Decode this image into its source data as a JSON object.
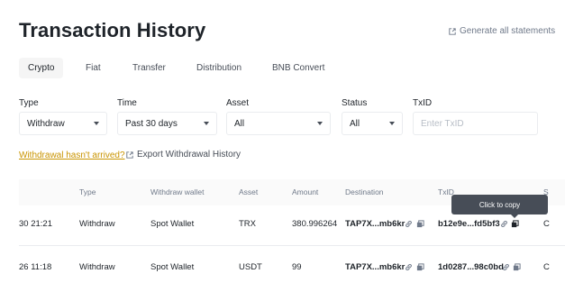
{
  "header": {
    "title": "Transaction History",
    "generate_statements": "Generate all statements"
  },
  "tabs": [
    "Crypto",
    "Fiat",
    "Transfer",
    "Distribution",
    "BNB Convert"
  ],
  "filters": {
    "type": {
      "label": "Type",
      "value": "Withdraw"
    },
    "time": {
      "label": "Time",
      "value": "Past 30 days"
    },
    "asset": {
      "label": "Asset",
      "value": "All"
    },
    "status": {
      "label": "Status",
      "value": "All"
    },
    "txid": {
      "label": "TxID",
      "placeholder": "Enter TxID"
    }
  },
  "links": {
    "withdrawal_not_arrived": "Withdrawal hasn't arrived?",
    "export_history": "Export Withdrawal History"
  },
  "table": {
    "columns": [
      "Type",
      "Withdraw wallet",
      "Asset",
      "Amount",
      "Destination",
      "TxID",
      "S"
    ],
    "rows": [
      {
        "time": "30 21:21",
        "type": "Withdraw",
        "wallet": "Spot Wallet",
        "asset": "TRX",
        "amount": "380.996264",
        "destination": "TAP7X...mb6kr",
        "txid": "b12e9e...fd5bf3",
        "status": "C"
      },
      {
        "time": "26 11:18",
        "type": "Withdraw",
        "wallet": "Spot Wallet",
        "asset": "USDT",
        "amount": "99",
        "destination": "TAP7X...mb6kr",
        "txid": "1d0287...98c0bd",
        "status": "C"
      }
    ]
  },
  "tooltip": {
    "text": "Click to copy"
  },
  "icons": {
    "link": "link-icon",
    "copy": "copy-icon",
    "external": "external-link-icon"
  },
  "colors": {
    "accent_link": "#c99400",
    "text_primary": "#1e2329",
    "text_secondary": "#707a8a",
    "tooltip_bg": "#474d57"
  }
}
